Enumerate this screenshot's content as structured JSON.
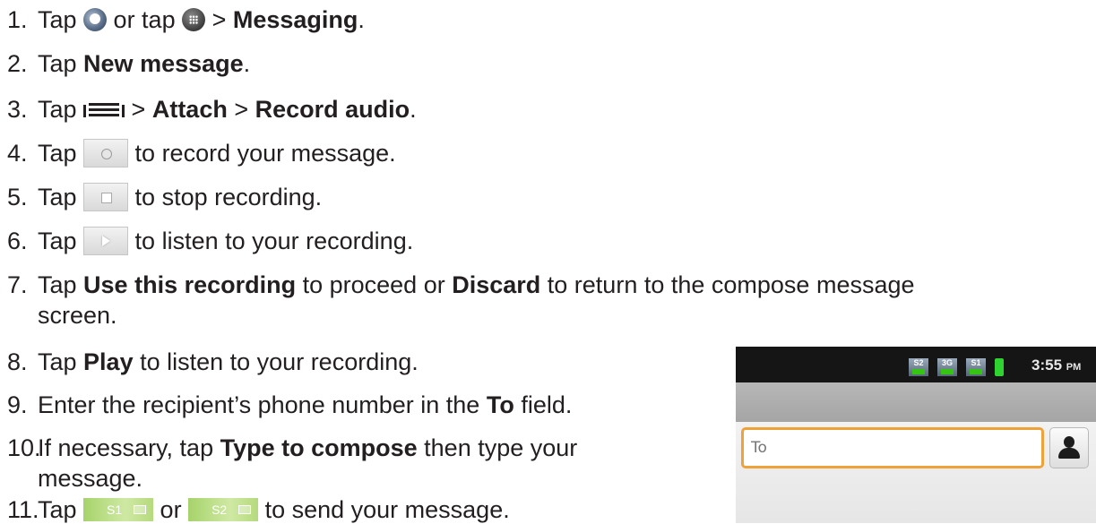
{
  "steps": [
    {
      "num": "1.",
      "a": "Tap ",
      "b": " or tap ",
      "c": " > ",
      "d": "Messaging",
      "e": "."
    },
    {
      "num": "2.",
      "a": "Tap ",
      "b": "New message",
      "c": "."
    },
    {
      "num": "3.",
      "a": "Tap ",
      "b": " > ",
      "c": "Attach",
      "d": " > ",
      "e": "Record audio",
      "f": "."
    },
    {
      "num": "4.",
      "a": "Tap ",
      "b": " to record your message."
    },
    {
      "num": "5.",
      "a": "Tap ",
      "b": " to stop recording."
    },
    {
      "num": "6.",
      "a": "Tap ",
      "b": " to listen to your recording."
    },
    {
      "num": "7.",
      "a": "Tap ",
      "b": "Use this recording",
      "c": " to proceed or ",
      "d": "Discard",
      "e": " to return to the compose message",
      "f": "screen."
    },
    {
      "num": "8.",
      "a": "Tap ",
      "b": "Play",
      "c": " to listen to your recording."
    },
    {
      "num": "9.",
      "a": "Enter the recipient’s phone number in the ",
      "b": "To",
      "c": " field."
    },
    {
      "num": "10.",
      "a": "If necessary, tap ",
      "b": "Type to compose",
      "c": " then type your",
      "d": "message."
    },
    {
      "num": "11.",
      "a": "Tap ",
      "b": " or ",
      "c": " to send your message."
    }
  ],
  "icons": {
    "messaging": "messaging-icon",
    "apps": "apps-icon",
    "menu": "menu-icon",
    "record": "record-icon",
    "stop": "stop-icon",
    "play": "play-icon",
    "send1": {
      "label": "S1",
      "icon": "send-envelope-icon"
    },
    "send2": {
      "label": "S2",
      "icon": "send-envelope-icon"
    }
  },
  "phone": {
    "status": {
      "sim2": "S2",
      "network": "3G",
      "sim1": "S1",
      "time": "3:55",
      "ampm": "PM"
    },
    "to_placeholder": "To",
    "colors": {
      "field_border": "#f0a23a",
      "status_bg": "#151515",
      "battery": "#2fd32f"
    }
  }
}
